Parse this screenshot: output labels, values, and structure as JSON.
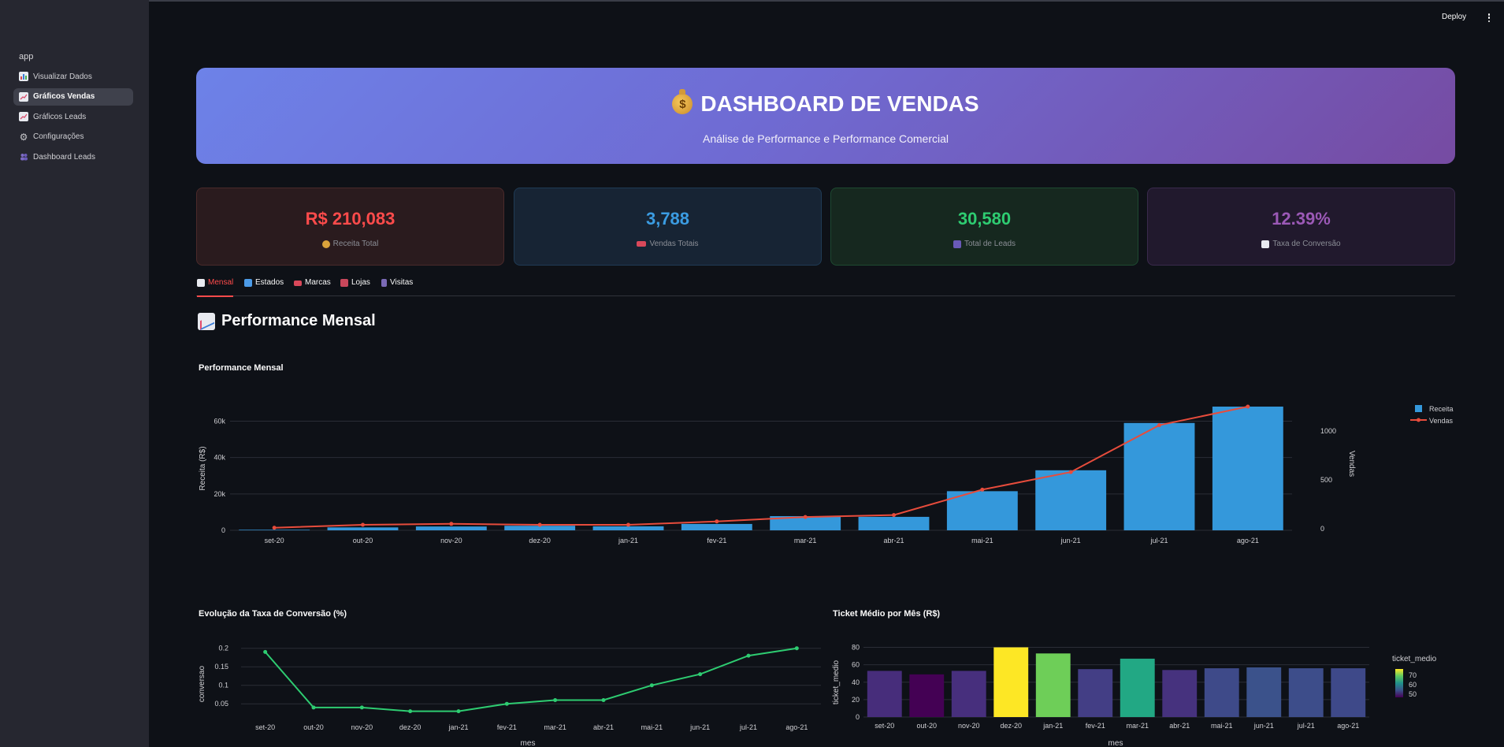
{
  "sidebar": {
    "app_label": "app",
    "items": [
      {
        "label": "Visualizar Dados",
        "icon": "bar-chart-icon",
        "active": false
      },
      {
        "label": "Gráficos Vendas",
        "icon": "line-chart-icon",
        "active": true
      },
      {
        "label": "Gráficos Leads",
        "icon": "line-chart-icon",
        "active": false
      },
      {
        "label": "Configurações",
        "icon": "gear-icon",
        "active": false
      },
      {
        "label": "Dashboard Leads",
        "icon": "people-icon",
        "active": false
      }
    ]
  },
  "header": {
    "deploy_label": "Deploy"
  },
  "hero": {
    "title": "DASHBOARD DE VENDAS",
    "icon": "money-bag-icon",
    "subtitle": "Análise de Performance e Performance Comercial"
  },
  "kpis": [
    {
      "value": "R$ 210,083",
      "label": "Receita Total",
      "icon": "money-bag-icon",
      "color": "#ff4b4b"
    },
    {
      "value": "3,788",
      "label": "Vendas Totais",
      "icon": "delivery-truck-icon",
      "color": "#3b9ce2"
    },
    {
      "value": "30,580",
      "label": "Total de Leads",
      "icon": "people-icon",
      "color": "#2ecc71"
    },
    {
      "value": "12.39%",
      "label": "Taxa de Conversão",
      "icon": "bar-chart-icon",
      "color": "#9b59b6"
    }
  ],
  "tabs": [
    {
      "label": "Mensal",
      "icon": "line-chart-icon",
      "active": true
    },
    {
      "label": "Estados",
      "icon": "map-icon",
      "active": false
    },
    {
      "label": "Marcas",
      "icon": "car-icon",
      "active": false
    },
    {
      "label": "Lojas",
      "icon": "store-icon",
      "active": false
    },
    {
      "label": "Visitas",
      "icon": "phone-icon",
      "active": false
    }
  ],
  "section": {
    "title": "Performance Mensal",
    "icon": "line-chart-icon"
  },
  "chart_data": [
    {
      "type": "bar",
      "title": "Performance Mensal",
      "categories": [
        "set-20",
        "out-20",
        "nov-20",
        "dez-20",
        "jan-21",
        "fev-21",
        "mar-21",
        "abr-21",
        "mai-21",
        "jun-21",
        "jul-21",
        "ago-21"
      ],
      "ylabel": "Receita (R$)",
      "y2label": "Vendas",
      "ylim": [
        0,
        68000
      ],
      "y_ticks": [
        "0",
        "20k",
        "40k",
        "60k"
      ],
      "y2lim": [
        0,
        1250
      ],
      "y2_ticks": [
        "0",
        "500",
        "1000"
      ],
      "series": [
        {
          "name": "Receita",
          "kind": "bar",
          "axis": "y",
          "color": "#3498db",
          "values": [
            300,
            1600,
            2100,
            2500,
            2200,
            3500,
            7800,
            7400,
            21500,
            33000,
            59000,
            68000
          ]
        },
        {
          "name": "Vendas",
          "kind": "line",
          "axis": "y2",
          "color": "#e74c3c",
          "values": [
            10,
            40,
            50,
            40,
            40,
            75,
            120,
            140,
            400,
            580,
            1060,
            1250
          ]
        }
      ],
      "legend": "top-right",
      "grid": true
    },
    {
      "type": "line",
      "title": "Evolução da Taxa de Conversão (%)",
      "categories": [
        "set-20",
        "out-20",
        "nov-20",
        "dez-20",
        "jan-21",
        "fev-21",
        "mar-21",
        "abr-21",
        "mai-21",
        "jun-21",
        "jul-21",
        "ago-21"
      ],
      "xlabel": "mes",
      "ylabel": "conversao",
      "ylim": [
        0.01,
        0.21
      ],
      "y_ticks": [
        0.05,
        0.1,
        0.15,
        0.2
      ],
      "y_tick_labels": [
        "0.05",
        "0.1",
        "0.15",
        "0.2"
      ],
      "series": [
        {
          "color": "#2ecc71",
          "values": [
            0.19,
            0.04,
            0.04,
            0.03,
            0.03,
            0.05,
            0.06,
            0.06,
            0.1,
            0.13,
            0.18,
            0.2
          ]
        }
      ],
      "grid": true
    },
    {
      "type": "bar",
      "title": "Ticket Médio por Mês (R$)",
      "categories": [
        "set-20",
        "out-20",
        "nov-20",
        "dez-20",
        "jan-21",
        "fev-21",
        "mar-21",
        "abr-21",
        "mai-21",
        "jun-21",
        "jul-21",
        "ago-21"
      ],
      "xlabel": "mes",
      "ylabel": "ticket_medio",
      "ylim": [
        0,
        85
      ],
      "y_ticks": [
        0,
        20,
        40,
        60,
        80
      ],
      "values": [
        53,
        49,
        53,
        80,
        73,
        55,
        67,
        54,
        56,
        57,
        56,
        56
      ],
      "colors": [
        "#472d7b",
        "#440154",
        "#472f7d",
        "#fde725",
        "#6ece58",
        "#433e85",
        "#22a884",
        "#46327e",
        "#3e4a89",
        "#3b528b",
        "#3d4d8a",
        "#3e4989"
      ],
      "colorbar": {
        "title": "ticket_medio",
        "ticks": [
          "70",
          "60",
          "50"
        ]
      },
      "grid": true
    }
  ]
}
